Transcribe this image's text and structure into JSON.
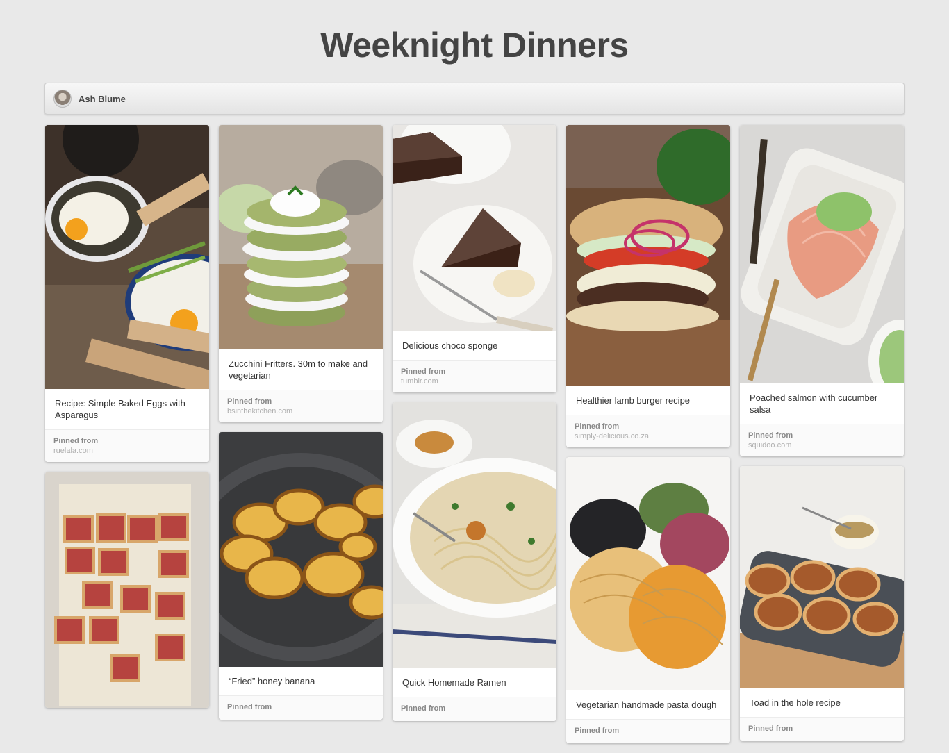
{
  "board": {
    "title": "Weeknight Dinners"
  },
  "owner": {
    "name": "Ash Blume"
  },
  "source_label": "Pinned from",
  "pins": [
    {
      "description": "Recipe: Simple Baked Eggs with Asparagus",
      "source": "ruelala.com",
      "image": "baked-eggs-asparagus-image"
    },
    {
      "description": "Zucchini Fritters. 30m to make and vegetarian",
      "source": "bsinthekitchen.com",
      "image": "zucchini-fritters-image"
    },
    {
      "description": "Delicious choco sponge",
      "source": "tumblr.com",
      "image": "choco-sponge-image"
    },
    {
      "description": "Healthier lamb burger recipe",
      "source": "simply-delicious.co.za",
      "image": "lamb-burger-image"
    },
    {
      "description": "Poached salmon with cucumber salsa",
      "source": "squidoo.com",
      "image": "poached-salmon-image"
    },
    {
      "description": "",
      "source": "",
      "image": "berry-crumble-bars-image"
    },
    {
      "description": "“Fried” honey banana",
      "source": "",
      "image": "fried-honey-banana-image"
    },
    {
      "description": "Quick Homemade Ramen",
      "source": "",
      "image": "homemade-ramen-image"
    },
    {
      "description": "Vegetarian handmade pasta dough",
      "source": "",
      "image": "handmade-pasta-image"
    },
    {
      "description": "Toad in the hole recipe",
      "source": "",
      "image": "toad-in-the-hole-image"
    }
  ]
}
